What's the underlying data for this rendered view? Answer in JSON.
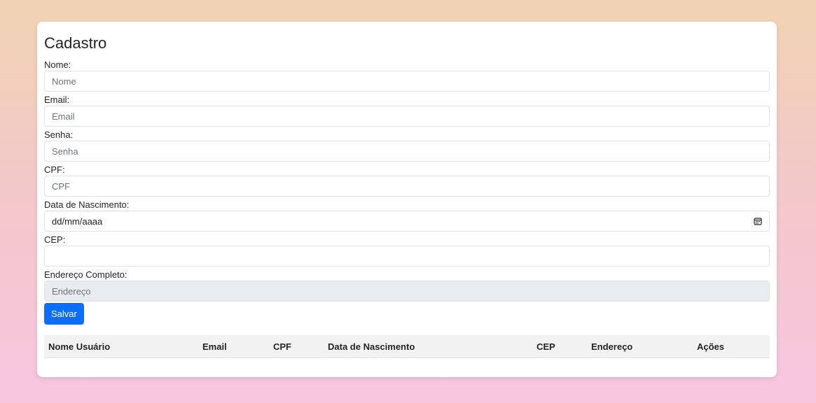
{
  "form": {
    "title": "Cadastro",
    "fields": [
      {
        "label": "Nome:",
        "placeholder": "Nome"
      },
      {
        "label": "Email:",
        "placeholder": "Email"
      },
      {
        "label": "Senha:",
        "placeholder": "Senha"
      },
      {
        "label": "CPF:",
        "placeholder": "CPF"
      },
      {
        "label": "Data de Nascimento:",
        "value": "dd/mm/aaaa",
        "icon": "calendar-icon"
      },
      {
        "label": "CEP:",
        "placeholder": ""
      },
      {
        "label": "Endereço Completo:",
        "placeholder": "Endereço"
      }
    ],
    "save_label": "Salvar"
  },
  "table": {
    "headers": [
      "Nome Usuário",
      "Email",
      "CPF",
      "Data de Nascimento",
      "CEP",
      "Endereço",
      "Ações"
    ]
  },
  "colors": {
    "primary": "#0d6efd",
    "disabled_bg": "#e9ecef",
    "header_bg": "#f2f2f2"
  }
}
